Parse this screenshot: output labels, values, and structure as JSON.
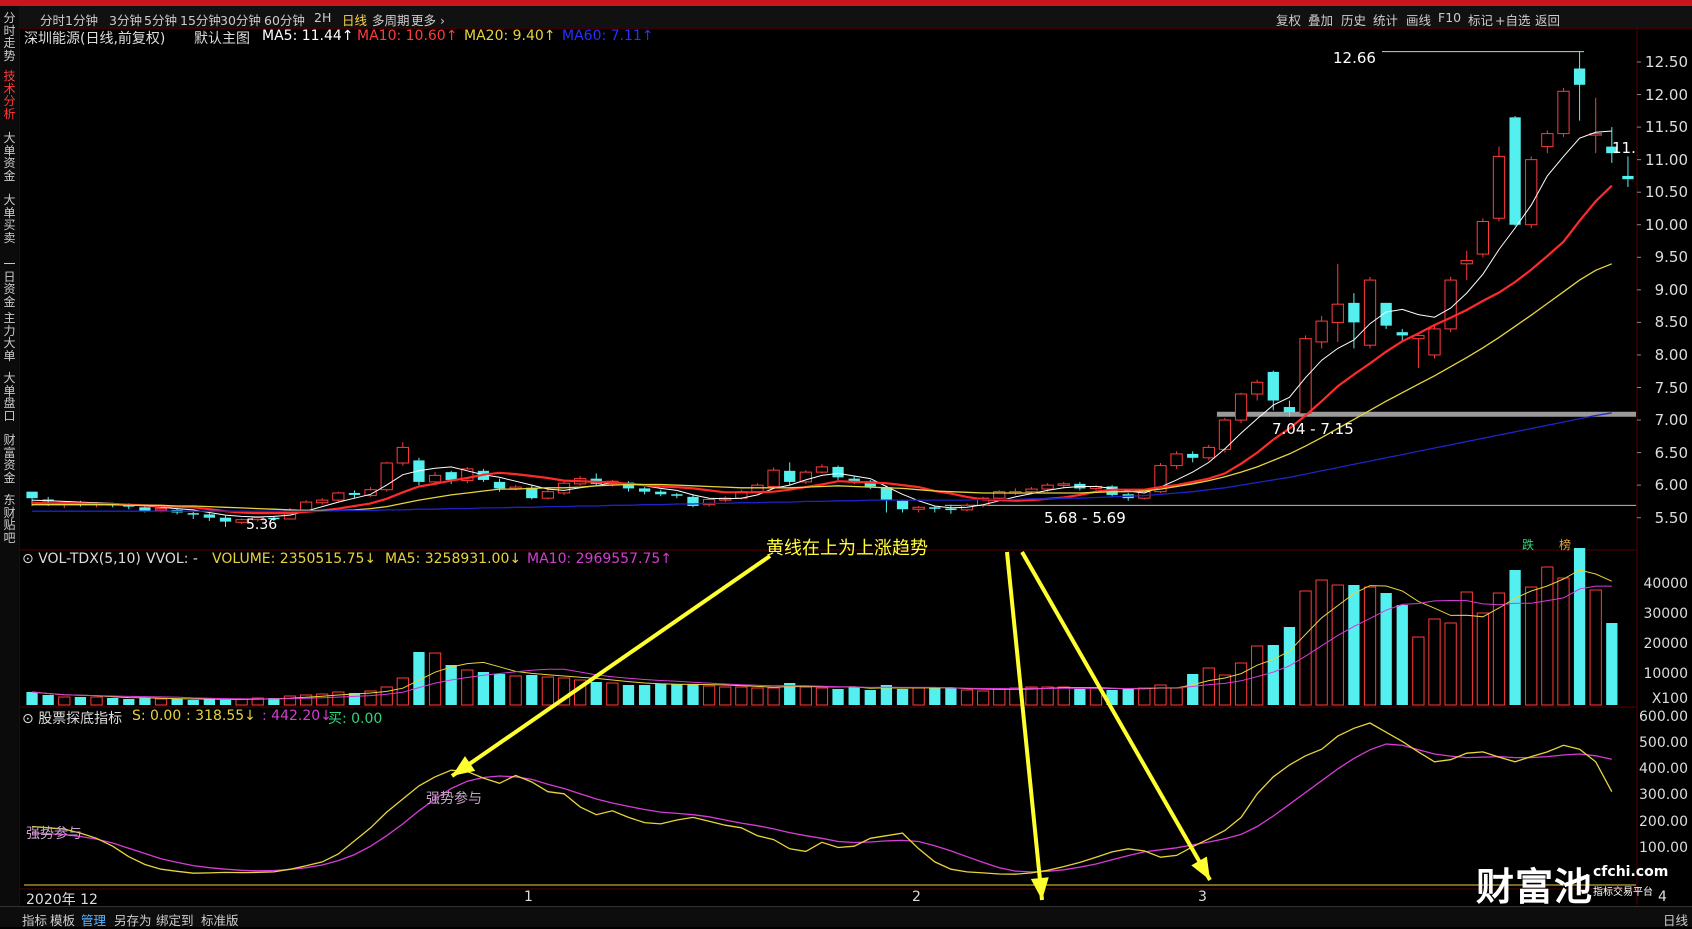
{
  "toolbar": {
    "periods": [
      "分时",
      "1分钟",
      "3分钟",
      "5分钟",
      "15分钟",
      "30分钟",
      "60分钟",
      "2H",
      "日线",
      "多周期",
      "更多"
    ],
    "active_period": "日线",
    "right_tools": [
      "复权",
      "叠加",
      "历史",
      "统计",
      "画线",
      "F10",
      "标记",
      "+自选",
      "返回"
    ]
  },
  "side_tabs": [
    "分时走势",
    "技术分析",
    "大单资金",
    "大单买卖",
    "一日资金",
    "主力大单",
    "大单盘口",
    "财富资金",
    "东财贴吧"
  ],
  "main_header": {
    "title": "深圳能源(日线,前复权)",
    "main_chart": "默认主图",
    "ma5": "MA5: 11.44↑",
    "ma10": "MA10: 10.60↑",
    "ma20": "MA20: 9.40↑",
    "ma60": "MA60: 7.11↑"
  },
  "price_axis": [
    "12.50",
    "12.00",
    "11.50",
    "11.00",
    "10.50",
    "10.00",
    "9.50",
    "9.00",
    "8.50",
    "8.00",
    "7.50",
    "7.00",
    "6.50",
    "6.00",
    "5.50"
  ],
  "annotations": {
    "high": "12.66",
    "last_partial": "11.",
    "low": "5.36",
    "support_band": "7.04 - 7.15",
    "bottom_band": "5.68 - 5.69",
    "callout": "黄线在上为上涨趋势",
    "signal_die": "跌",
    "signal_bang": "榜"
  },
  "vol_header": {
    "name": "VOL-TDX(5,10)",
    "vvol": "VVOL: -",
    "volume": "VOLUME: 2350515.75↓",
    "ma5": "MA5: 3258931.00↓",
    "ma10": "MA10: 2969557.75↑"
  },
  "vol_axis": [
    "40000",
    "30000",
    "20000",
    "10000",
    "X100"
  ],
  "ind_header": {
    "name": "股票探底指标",
    "s": "S: 0.00",
    "v1": ": 318.55↓",
    "v2": ": 442.20↓",
    "buy": "买: 0.00"
  },
  "ind_axis": [
    "600.00",
    "500.00",
    "400.00",
    "300.00",
    "200.00",
    "100.00"
  ],
  "ind_labels": {
    "a": "强势参与",
    "b": "强势参与"
  },
  "date_axis": [
    "2020年 12",
    "1",
    "2",
    "3",
    "4"
  ],
  "watermark": {
    "brand": "财富池",
    "domain": "cfchi.com",
    "tagline": "指标交易平台"
  },
  "bottom_tabs": [
    "指标",
    "模板",
    "管理",
    "另存为",
    "绑定到",
    "标准版"
  ],
  "bottom_active": "管理",
  "bottom_right": "日线",
  "colors": {
    "up": "#ff3b3b",
    "down": "#54f0f0",
    "ma5": "#ffffff",
    "ma10": "#ff2a2a",
    "ma20": "#e6d43c",
    "ma60": "#1c24c8"
  },
  "chart_data": {
    "type": "candlestick",
    "ohlc": [
      [
        5.9,
        5.8,
        5.8,
        5.68
      ],
      [
        5.78,
        5.75,
        5.82,
        5.68
      ],
      [
        5.7,
        5.73,
        5.75,
        5.65
      ],
      [
        5.72,
        5.7,
        5.76,
        5.67
      ],
      [
        5.7,
        5.72,
        5.74,
        5.66
      ],
      [
        5.71,
        5.7,
        5.73,
        5.66
      ],
      [
        5.7,
        5.67,
        5.72,
        5.63
      ],
      [
        5.66,
        5.6,
        5.69,
        5.58
      ],
      [
        5.62,
        5.64,
        5.66,
        5.58
      ],
      [
        5.62,
        5.58,
        5.64,
        5.55
      ],
      [
        5.57,
        5.55,
        5.59,
        5.48
      ],
      [
        5.55,
        5.5,
        5.57,
        5.45
      ],
      [
        5.5,
        5.44,
        5.53,
        5.36
      ],
      [
        5.43,
        5.47,
        5.49,
        5.4
      ],
      [
        5.47,
        5.5,
        5.52,
        5.44
      ],
      [
        5.5,
        5.48,
        5.53,
        5.45
      ],
      [
        5.48,
        5.62,
        5.65,
        5.47
      ],
      [
        5.62,
        5.74,
        5.77,
        5.6
      ],
      [
        5.73,
        5.77,
        5.8,
        5.7
      ],
      [
        5.77,
        5.88,
        5.9,
        5.75
      ],
      [
        5.88,
        5.85,
        5.92,
        5.8
      ],
      [
        5.84,
        5.93,
        5.97,
        5.82
      ],
      [
        5.93,
        6.34,
        6.36,
        5.9
      ],
      [
        6.34,
        6.58,
        6.66,
        6.3
      ],
      [
        6.38,
        6.05,
        6.42,
        6.0
      ],
      [
        6.05,
        6.15,
        6.2,
        6.02
      ],
      [
        6.2,
        6.08,
        6.22,
        6.02
      ],
      [
        6.07,
        6.25,
        6.28,
        6.03
      ],
      [
        6.22,
        6.08,
        6.25,
        6.05
      ],
      [
        6.05,
        5.95,
        6.1,
        5.9
      ],
      [
        5.95,
        5.97,
        6.0,
        5.92
      ],
      [
        5.96,
        5.8,
        6.0,
        5.78
      ],
      [
        5.8,
        5.9,
        5.95,
        5.78
      ],
      [
        5.88,
        6.03,
        6.06,
        5.85
      ],
      [
        6.02,
        6.1,
        6.14,
        5.99
      ],
      [
        6.1,
        6.02,
        6.18,
        6.0
      ],
      [
        6.02,
        6.06,
        6.08,
        5.98
      ],
      [
        6.04,
        5.95,
        6.06,
        5.9
      ],
      [
        5.95,
        5.9,
        5.97,
        5.86
      ],
      [
        5.9,
        5.86,
        5.93,
        5.83
      ],
      [
        5.86,
        5.84,
        5.88,
        5.8
      ],
      [
        5.82,
        5.68,
        5.86,
        5.66
      ],
      [
        5.7,
        5.78,
        5.8,
        5.67
      ],
      [
        5.77,
        5.8,
        5.83,
        5.74
      ],
      [
        5.8,
        5.9,
        5.93,
        5.78
      ],
      [
        5.9,
        6.0,
        6.03,
        5.88
      ],
      [
        5.98,
        6.23,
        6.27,
        5.96
      ],
      [
        6.22,
        6.05,
        6.35,
        6.0
      ],
      [
        6.05,
        6.2,
        6.23,
        6.02
      ],
      [
        6.2,
        6.28,
        6.32,
        6.18
      ],
      [
        6.28,
        6.12,
        6.3,
        6.08
      ],
      [
        6.1,
        6.06,
        6.14,
        6.02
      ],
      [
        6.06,
        5.98,
        6.08,
        5.94
      ],
      [
        5.97,
        5.77,
        5.99,
        5.58
      ],
      [
        5.76,
        5.63,
        5.78,
        5.58
      ],
      [
        5.63,
        5.66,
        5.68,
        5.58
      ],
      [
        5.66,
        5.64,
        5.68,
        5.58
      ],
      [
        5.64,
        5.63,
        5.7,
        5.56
      ],
      [
        5.62,
        5.69,
        5.72,
        5.6
      ],
      [
        5.69,
        5.8,
        5.82,
        5.66
      ],
      [
        5.8,
        5.9,
        5.92,
        5.76
      ],
      [
        5.9,
        5.9,
        5.95,
        5.85
      ],
      [
        5.9,
        5.94,
        5.97,
        5.86
      ],
      [
        5.94,
        6.0,
        6.03,
        5.9
      ],
      [
        6.0,
        6.02,
        6.05,
        5.96
      ],
      [
        6.02,
        5.95,
        6.05,
        5.92
      ],
      [
        5.95,
        5.98,
        6.0,
        5.92
      ],
      [
        5.98,
        5.85,
        6.0,
        5.82
      ],
      [
        5.86,
        5.8,
        5.88,
        5.76
      ],
      [
        5.8,
        5.9,
        5.93,
        5.78
      ],
      [
        5.9,
        6.3,
        6.34,
        5.88
      ],
      [
        6.3,
        6.48,
        6.52,
        6.25
      ],
      [
        6.48,
        6.42,
        6.52,
        6.35
      ],
      [
        6.42,
        6.58,
        6.62,
        6.38
      ],
      [
        6.55,
        7.0,
        7.03,
        6.5
      ],
      [
        7.0,
        7.4,
        7.42,
        6.95
      ],
      [
        7.4,
        7.58,
        7.62,
        7.3
      ],
      [
        7.74,
        7.3,
        7.76,
        7.15
      ],
      [
        7.2,
        7.12,
        7.3,
        7.05
      ],
      [
        7.1,
        8.25,
        8.3,
        7.05
      ],
      [
        8.2,
        8.52,
        8.6,
        8.1
      ],
      [
        8.5,
        8.78,
        9.4,
        8.2
      ],
      [
        8.8,
        8.5,
        8.95,
        8.1
      ],
      [
        8.15,
        9.15,
        9.2,
        8.1
      ],
      [
        8.8,
        8.45,
        8.8,
        8.4
      ],
      [
        8.35,
        8.3,
        8.4,
        8.2
      ],
      [
        8.25,
        8.3,
        8.32,
        7.8
      ],
      [
        8.0,
        8.4,
        8.45,
        7.95
      ],
      [
        8.4,
        9.15,
        9.2,
        8.35
      ],
      [
        9.4,
        9.45,
        9.6,
        9.15
      ],
      [
        9.55,
        10.05,
        10.1,
        9.5
      ],
      [
        10.1,
        11.05,
        11.2,
        10.05
      ],
      [
        11.65,
        10.0,
        11.67,
        9.98
      ],
      [
        10.0,
        11.0,
        11.05,
        9.95
      ],
      [
        11.2,
        11.4,
        11.45,
        11.1
      ],
      [
        11.4,
        12.05,
        12.1,
        11.35
      ],
      [
        12.4,
        12.15,
        12.66,
        11.6
      ],
      [
        11.4,
        11.4,
        11.95,
        11.1
      ],
      [
        11.2,
        11.1,
        11.5,
        10.95
      ],
      [
        10.75,
        10.7,
        11.05,
        10.58
      ]
    ],
    "ma_lines": {
      "ma5": [
        5.77,
        5.76,
        5.75,
        5.74,
        5.73,
        5.72,
        5.7,
        5.68,
        5.66,
        5.64,
        5.62,
        5.58,
        5.54,
        5.52,
        5.51,
        5.52,
        5.54,
        5.6,
        5.67,
        5.74,
        5.8,
        5.86,
        6.0,
        6.16,
        6.22,
        6.26,
        6.28,
        6.22,
        6.16,
        6.12,
        6.06,
        6.0,
        5.94,
        5.92,
        5.96,
        5.99,
        6.04,
        6.02,
        5.99,
        5.95,
        5.92,
        5.85,
        5.8,
        5.79,
        5.8,
        5.85,
        5.95,
        6.0,
        6.08,
        6.15,
        6.18,
        6.14,
        6.1,
        5.98,
        5.86,
        5.76,
        5.68,
        5.65,
        5.66,
        5.7,
        5.76,
        5.82,
        5.87,
        5.92,
        5.96,
        5.98,
        5.98,
        5.95,
        5.91,
        5.88,
        5.97,
        6.08,
        6.2,
        6.35,
        6.56,
        6.8,
        7.02,
        7.23,
        7.35,
        7.65,
        7.92,
        8.1,
        8.23,
        8.48,
        8.66,
        8.7,
        8.62,
        8.58,
        8.72,
        8.95,
        9.24,
        9.62,
        9.95,
        10.3,
        10.75,
        11.05,
        11.33,
        11.42,
        11.44
      ],
      "ma10": [
        5.73,
        5.72,
        5.72,
        5.72,
        5.71,
        5.71,
        5.7,
        5.69,
        5.68,
        5.67,
        5.66,
        5.63,
        5.6,
        5.58,
        5.57,
        5.57,
        5.57,
        5.59,
        5.61,
        5.64,
        5.68,
        5.72,
        5.79,
        5.89,
        5.98,
        6.02,
        6.07,
        6.11,
        6.16,
        6.19,
        6.17,
        6.14,
        6.11,
        6.07,
        6.06,
        6.05,
        6.04,
        6.02,
        6.0,
        5.98,
        5.97,
        5.95,
        5.92,
        5.89,
        5.89,
        5.89,
        5.9,
        5.93,
        5.97,
        6.01,
        6.06,
        6.05,
        6.04,
        6.03,
        6.0,
        5.97,
        5.91,
        5.87,
        5.82,
        5.78,
        5.77,
        5.76,
        5.77,
        5.79,
        5.81,
        5.85,
        5.9,
        5.93,
        5.93,
        5.93,
        5.97,
        6.0,
        6.05,
        6.1,
        6.18,
        6.33,
        6.5,
        6.7,
        6.87,
        7.07,
        7.29,
        7.52,
        7.7,
        7.87,
        8.05,
        8.21,
        8.33,
        8.46,
        8.57,
        8.69,
        8.83,
        8.96,
        9.12,
        9.31,
        9.52,
        9.74,
        10.06,
        10.36,
        10.6
      ],
      "ma20": [
        5.7,
        5.7,
        5.7,
        5.7,
        5.7,
        5.7,
        5.69,
        5.69,
        5.69,
        5.68,
        5.68,
        5.67,
        5.66,
        5.65,
        5.64,
        5.63,
        5.62,
        5.61,
        5.61,
        5.61,
        5.62,
        5.64,
        5.67,
        5.72,
        5.77,
        5.81,
        5.85,
        5.88,
        5.91,
        5.94,
        5.94,
        5.95,
        5.96,
        5.96,
        5.97,
        5.99,
        6.0,
        6.01,
        6.01,
        6.01,
        6.0,
        5.99,
        5.98,
        5.97,
        5.96,
        5.96,
        5.96,
        5.96,
        5.97,
        5.98,
        5.99,
        5.98,
        5.97,
        5.96,
        5.95,
        5.93,
        5.91,
        5.9,
        5.89,
        5.88,
        5.88,
        5.88,
        5.88,
        5.88,
        5.88,
        5.88,
        5.89,
        5.9,
        5.9,
        5.91,
        5.94,
        5.98,
        6.02,
        6.07,
        6.13,
        6.2,
        6.28,
        6.38,
        6.48,
        6.6,
        6.73,
        6.87,
        7.01,
        7.15,
        7.29,
        7.42,
        7.55,
        7.68,
        7.82,
        7.96,
        8.11,
        8.27,
        8.44,
        8.61,
        8.79,
        8.97,
        9.15,
        9.3,
        9.4
      ],
      "ma60": [
        5.6,
        5.6,
        5.6,
        5.6,
        5.6,
        5.6,
        5.6,
        5.6,
        5.6,
        5.6,
        5.6,
        5.6,
        5.6,
        5.6,
        5.6,
        5.6,
        5.6,
        5.6,
        5.6,
        5.61,
        5.61,
        5.61,
        5.62,
        5.62,
        5.63,
        5.63,
        5.64,
        5.64,
        5.65,
        5.65,
        5.66,
        5.66,
        5.67,
        5.67,
        5.68,
        5.68,
        5.69,
        5.69,
        5.7,
        5.7,
        5.71,
        5.71,
        5.72,
        5.72,
        5.73,
        5.73,
        5.74,
        5.74,
        5.75,
        5.75,
        5.76,
        5.76,
        5.77,
        5.77,
        5.77,
        5.77,
        5.77,
        5.77,
        5.77,
        5.78,
        5.78,
        5.78,
        5.79,
        5.79,
        5.8,
        5.8,
        5.81,
        5.82,
        5.83,
        5.84,
        5.86,
        5.88,
        5.9,
        5.93,
        5.96,
        6.0,
        6.04,
        6.08,
        6.12,
        6.17,
        6.22,
        6.27,
        6.32,
        6.37,
        6.42,
        6.47,
        6.52,
        6.57,
        6.62,
        6.67,
        6.72,
        6.77,
        6.82,
        6.87,
        6.92,
        6.97,
        7.02,
        7.07,
        7.11
      ]
    },
    "volume": [
      13,
      10,
      8,
      8,
      8,
      7,
      6,
      7,
      6,
      6,
      5,
      6,
      5,
      6,
      7,
      7,
      9,
      10,
      11,
      13,
      12,
      14,
      18,
      27,
      53,
      52,
      40,
      35,
      33,
      31,
      29,
      30,
      28,
      27,
      25,
      23,
      22,
      20,
      20,
      21,
      21,
      21,
      19,
      18,
      18,
      17,
      17,
      22,
      18,
      17,
      16,
      18,
      15,
      20,
      16,
      17,
      17,
      17,
      15,
      14,
      16,
      17,
      18,
      18,
      18,
      16,
      17,
      15,
      16,
      17,
      20,
      17,
      31,
      37,
      30,
      42,
      59,
      60,
      78,
      114,
      125,
      120,
      120,
      118,
      112,
      100,
      68,
      86,
      82,
      113,
      92,
      112,
      135,
      118,
      138,
      127,
      157,
      115,
      82
    ],
    "indicator": {
      "yellow": [
        185,
        180,
        175,
        160,
        140,
        110,
        70,
        40,
        22,
        14,
        7,
        8,
        10,
        9,
        10,
        12,
        22,
        35,
        50,
        80,
        130,
        180,
        240,
        290,
        340,
        375,
        400,
        395,
        370,
        350,
        380,
        355,
        318,
        310,
        260,
        230,
        245,
        220,
        200,
        195,
        210,
        220,
        205,
        190,
        180,
        150,
        135,
        100,
        90,
        125,
        105,
        110,
        140,
        150,
        160,
        100,
        50,
        22,
        12,
        8,
        4,
        3,
        8,
        18,
        32,
        48,
        68,
        88,
        100,
        92,
        68,
        75,
        108,
        138,
        170,
        220,
        310,
        375,
        420,
        455,
        480,
        530,
        560,
        580,
        545,
        510,
        470,
        432,
        440,
        465,
        470,
        450,
        432,
        452,
        470,
        495,
        480,
        432,
        318
      ],
      "purple": [
        160,
        158,
        154,
        147,
        137,
        122,
        102,
        82,
        62,
        48,
        36,
        28,
        22,
        18,
        16,
        17,
        21,
        28,
        38,
        55,
        78,
        110,
        150,
        195,
        245,
        290,
        330,
        358,
        372,
        378,
        375,
        365,
        346,
        330,
        310,
        290,
        275,
        262,
        250,
        240,
        235,
        230,
        222,
        210,
        198,
        188,
        176,
        162,
        150,
        140,
        128,
        124,
        126,
        130,
        132,
        128,
        112,
        92,
        70,
        48,
        28,
        15,
        12,
        14,
        20,
        30,
        42,
        58,
        74,
        88,
        96,
        104,
        115,
        126,
        138,
        155,
        185,
        225,
        270,
        315,
        360,
        405,
        445,
        478,
        500,
        495,
        478,
        462,
        454,
        448,
        450,
        452,
        448,
        448,
        452,
        458,
        462,
        455,
        442
      ]
    }
  }
}
